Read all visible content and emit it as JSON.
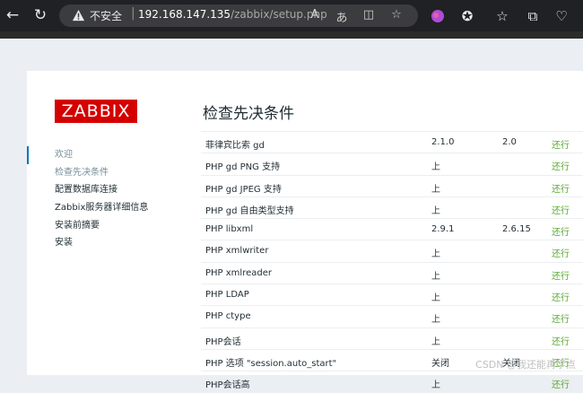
{
  "browser": {
    "insecure_label": "不安全",
    "url_host": "192.168.147.135",
    "url_path": "/zabbix/setup.php"
  },
  "logo": "ZABBIX",
  "page_title": "检查先决条件",
  "steps": [
    {
      "label": "欢迎"
    },
    {
      "label": "检查先决条件"
    },
    {
      "label": "配置数据库连接"
    },
    {
      "label": "Zabbix服务器详细信息"
    },
    {
      "label": "安装前摘要"
    },
    {
      "label": "安装"
    }
  ],
  "requirements": [
    {
      "name": "菲律宾比索 gd",
      "current": "2.1.0",
      "required": "2.0",
      "status": "还行"
    },
    {
      "name": "PHP gd PNG 支持",
      "current": "上",
      "required": "",
      "status": "还行"
    },
    {
      "name": "PHP gd JPEG 支持",
      "current": "上",
      "required": "",
      "status": "还行"
    },
    {
      "name": "PHP gd 自由类型支持",
      "current": "上",
      "required": "",
      "status": "还行"
    },
    {
      "name": "PHP libxml",
      "current": "2.9.1",
      "required": "2.6.15",
      "status": "还行"
    },
    {
      "name": "PHP xmlwriter",
      "current": "上",
      "required": "",
      "status": "还行"
    },
    {
      "name": "PHP xmlreader",
      "current": "上",
      "required": "",
      "status": "还行"
    },
    {
      "name": "PHP LDAP",
      "current": "上",
      "required": "",
      "status": "还行"
    },
    {
      "name": "PHP ctype",
      "current": "上",
      "required": "",
      "status": "还行"
    },
    {
      "name": "PHP会话",
      "current": "上",
      "required": "",
      "status": "还行"
    },
    {
      "name": "PHP 选项 \"session.auto_start\"",
      "current": "关闭",
      "required": "关闭",
      "status": "还行"
    },
    {
      "name": "PHP会话高",
      "current": "上",
      "required": "",
      "status": "还行"
    }
  ],
  "watermark": "CSDN @我还能再学点"
}
